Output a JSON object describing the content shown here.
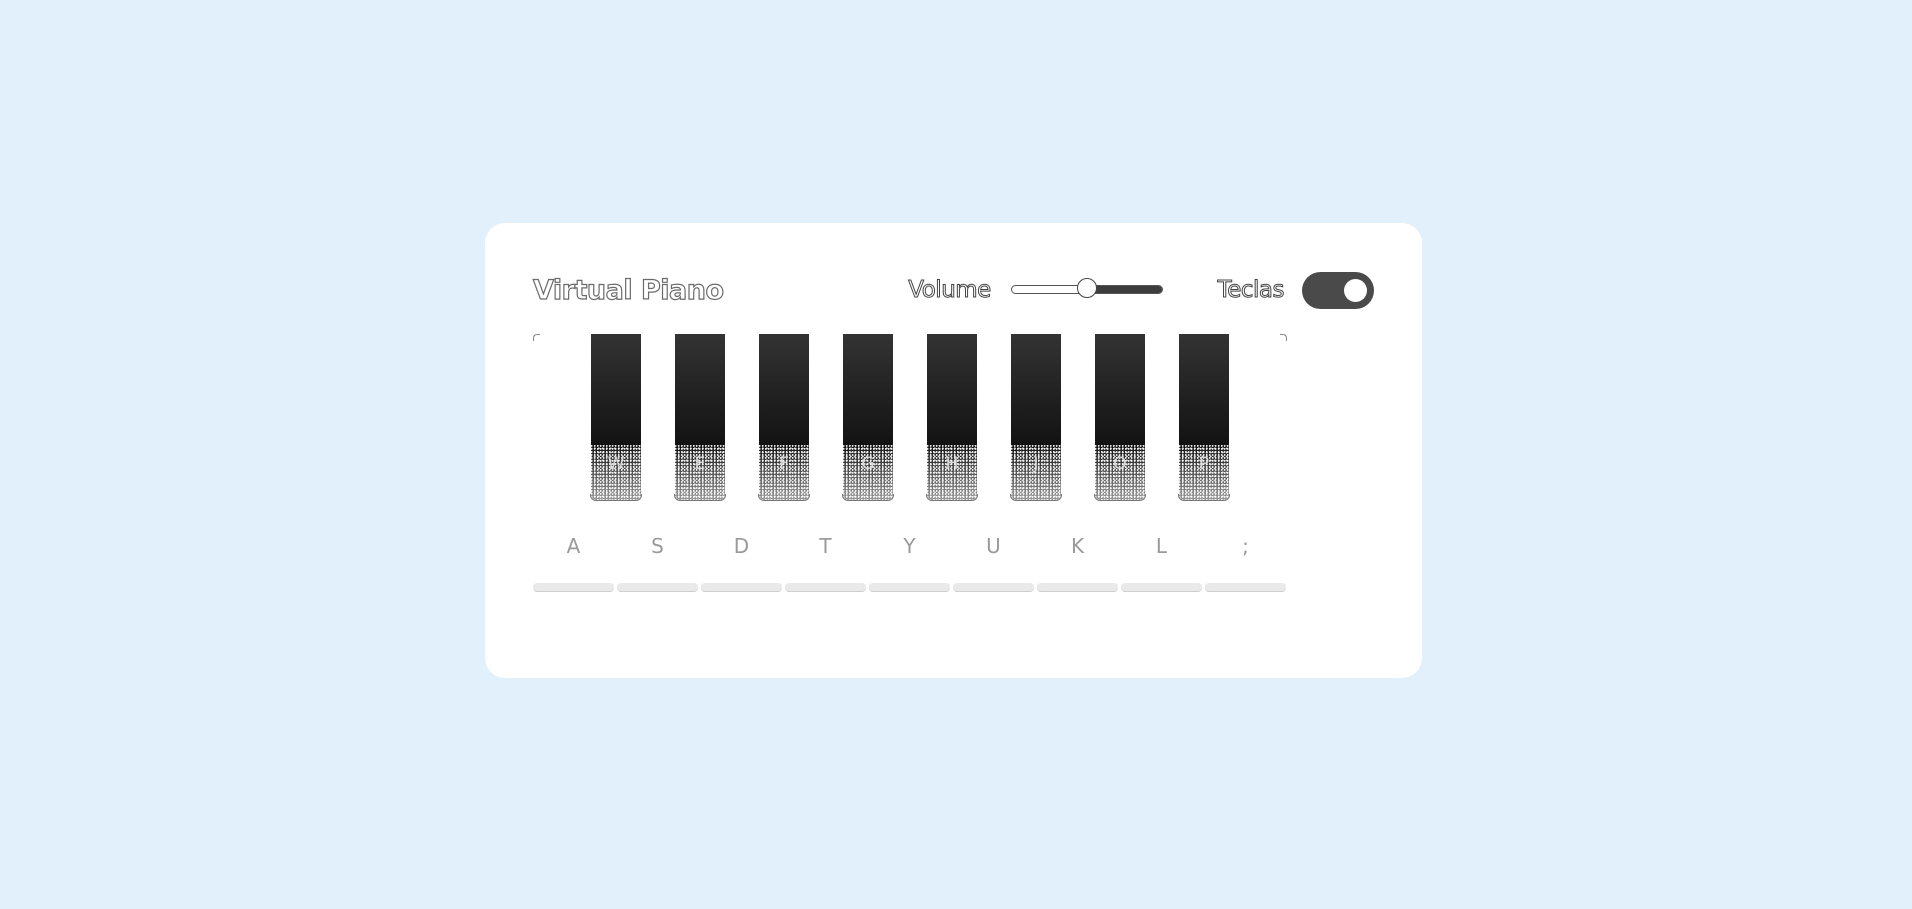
{
  "header": {
    "title": "Virtual Piano",
    "volume_label": "Volume",
    "volume_level": 0.5,
    "keys_toggle_label": "Teclas",
    "keys_toggle_on": true
  },
  "piano": {
    "black_keys": [
      "W",
      "E",
      "F",
      "G",
      "H",
      "J",
      "O",
      "P"
    ],
    "white_keys": [
      "A",
      "S",
      "D",
      "T",
      "Y",
      "U",
      "K",
      "L",
      ";"
    ]
  },
  "colors": {
    "background": "#e2f0fb",
    "card": "#ffffff",
    "black_key": "#1a1a1a",
    "toggle": "#4a4a4a"
  }
}
